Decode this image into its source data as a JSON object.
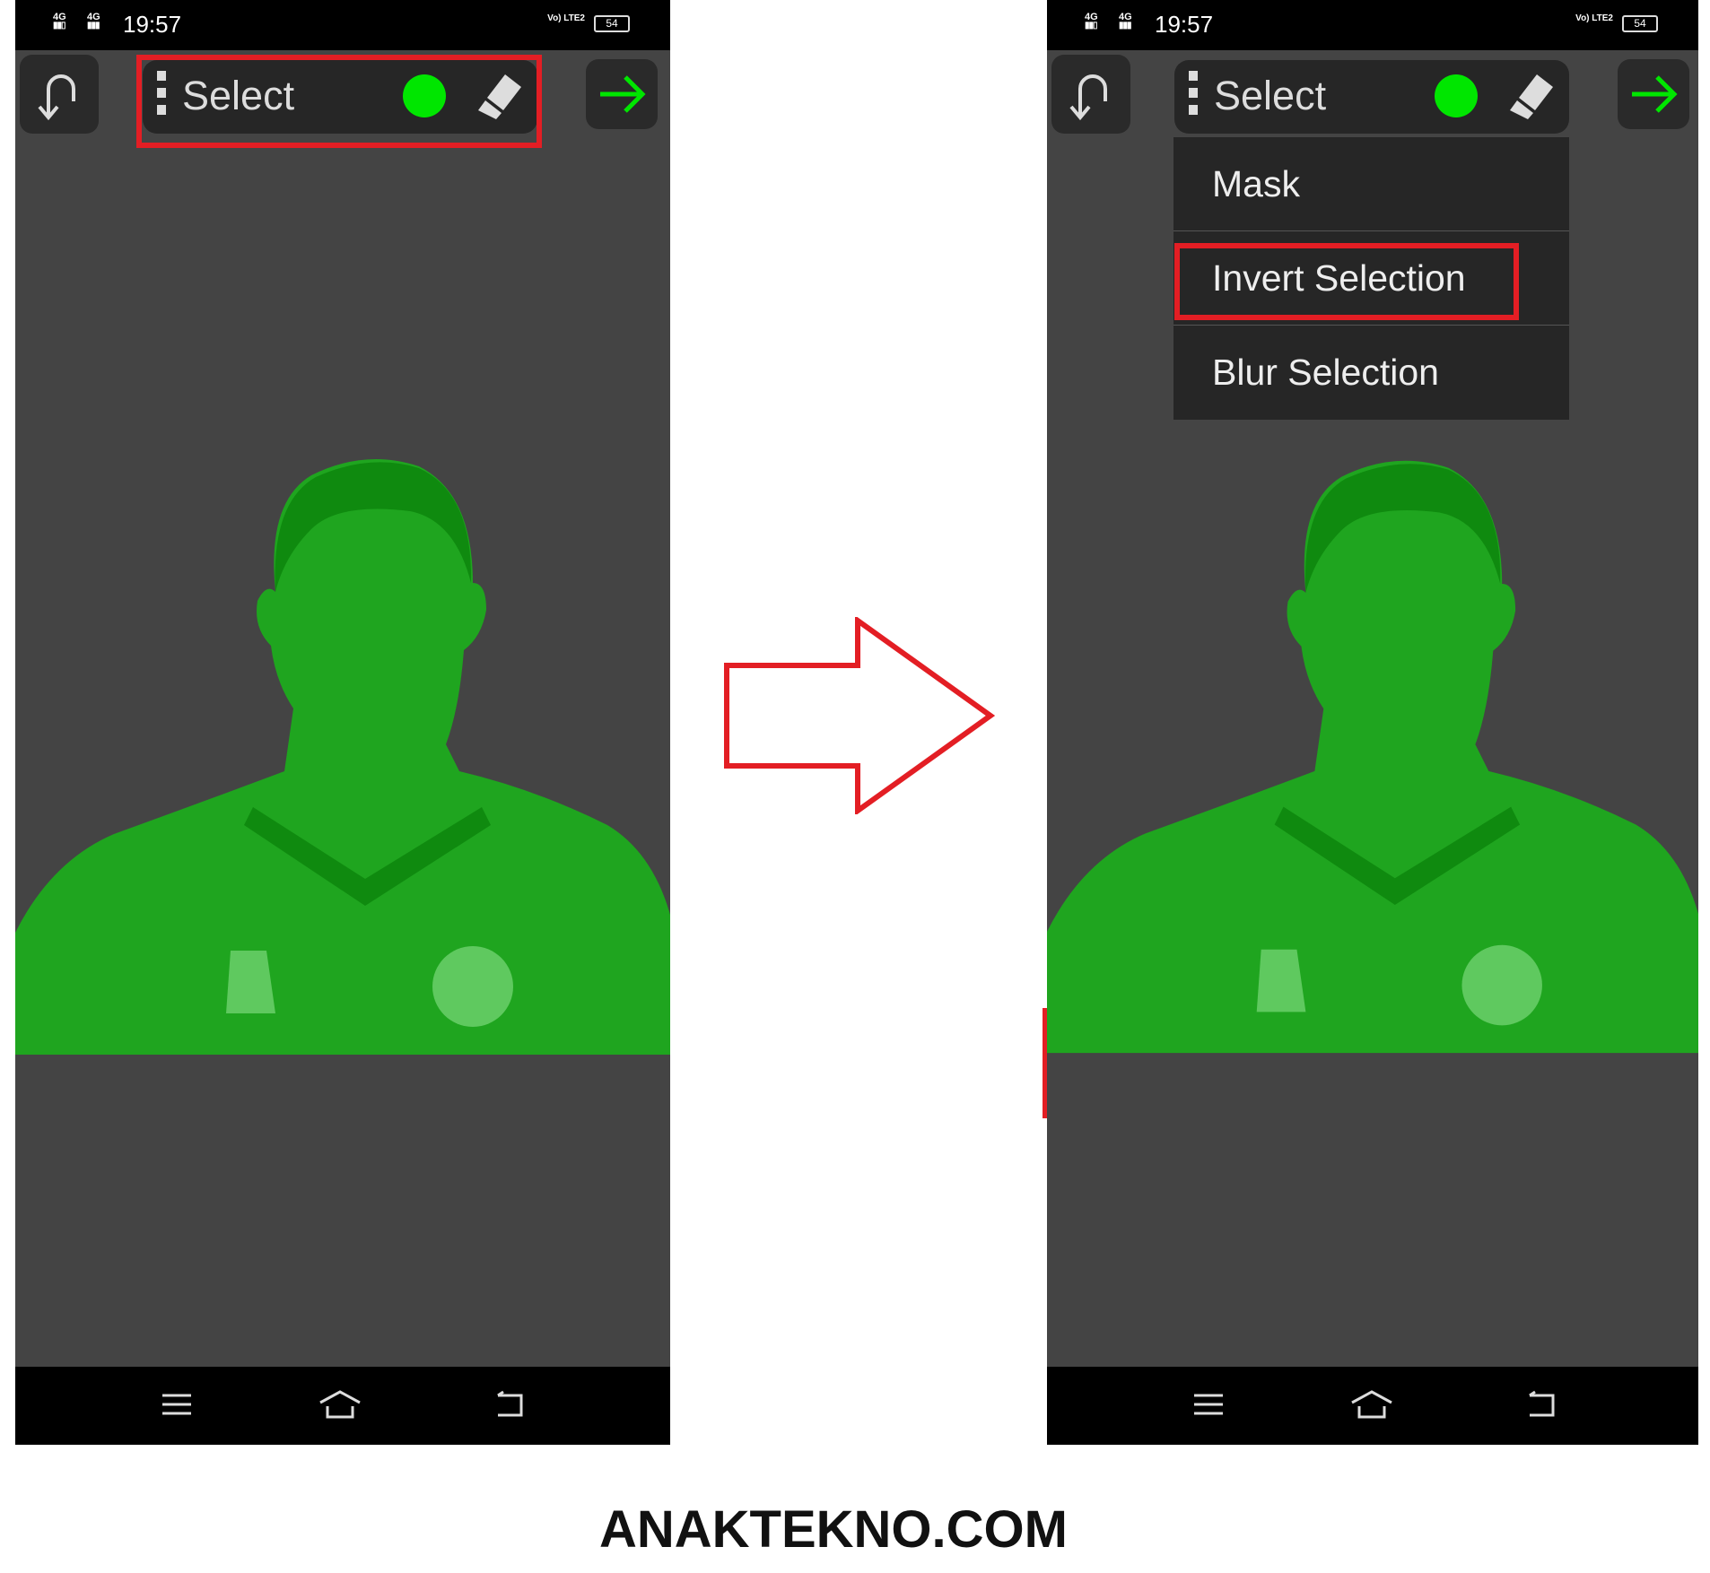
{
  "status_bar": {
    "signal1": "4G",
    "signal2": "4G",
    "time": "19:57",
    "volte": "Vo) LTE2",
    "battery": "54"
  },
  "toolbar": {
    "mode_label": "Select",
    "brush_color": "#00e600"
  },
  "menu": {
    "items": [
      "Mask",
      "Invert Selection",
      "Blur Selection"
    ],
    "highlighted": "Invert Selection"
  },
  "colors": {
    "highlight": "#e31e24",
    "accent": "#00e600",
    "mask_green": "#1fa51f"
  },
  "watermark": "ANAKTEKNO.COM"
}
